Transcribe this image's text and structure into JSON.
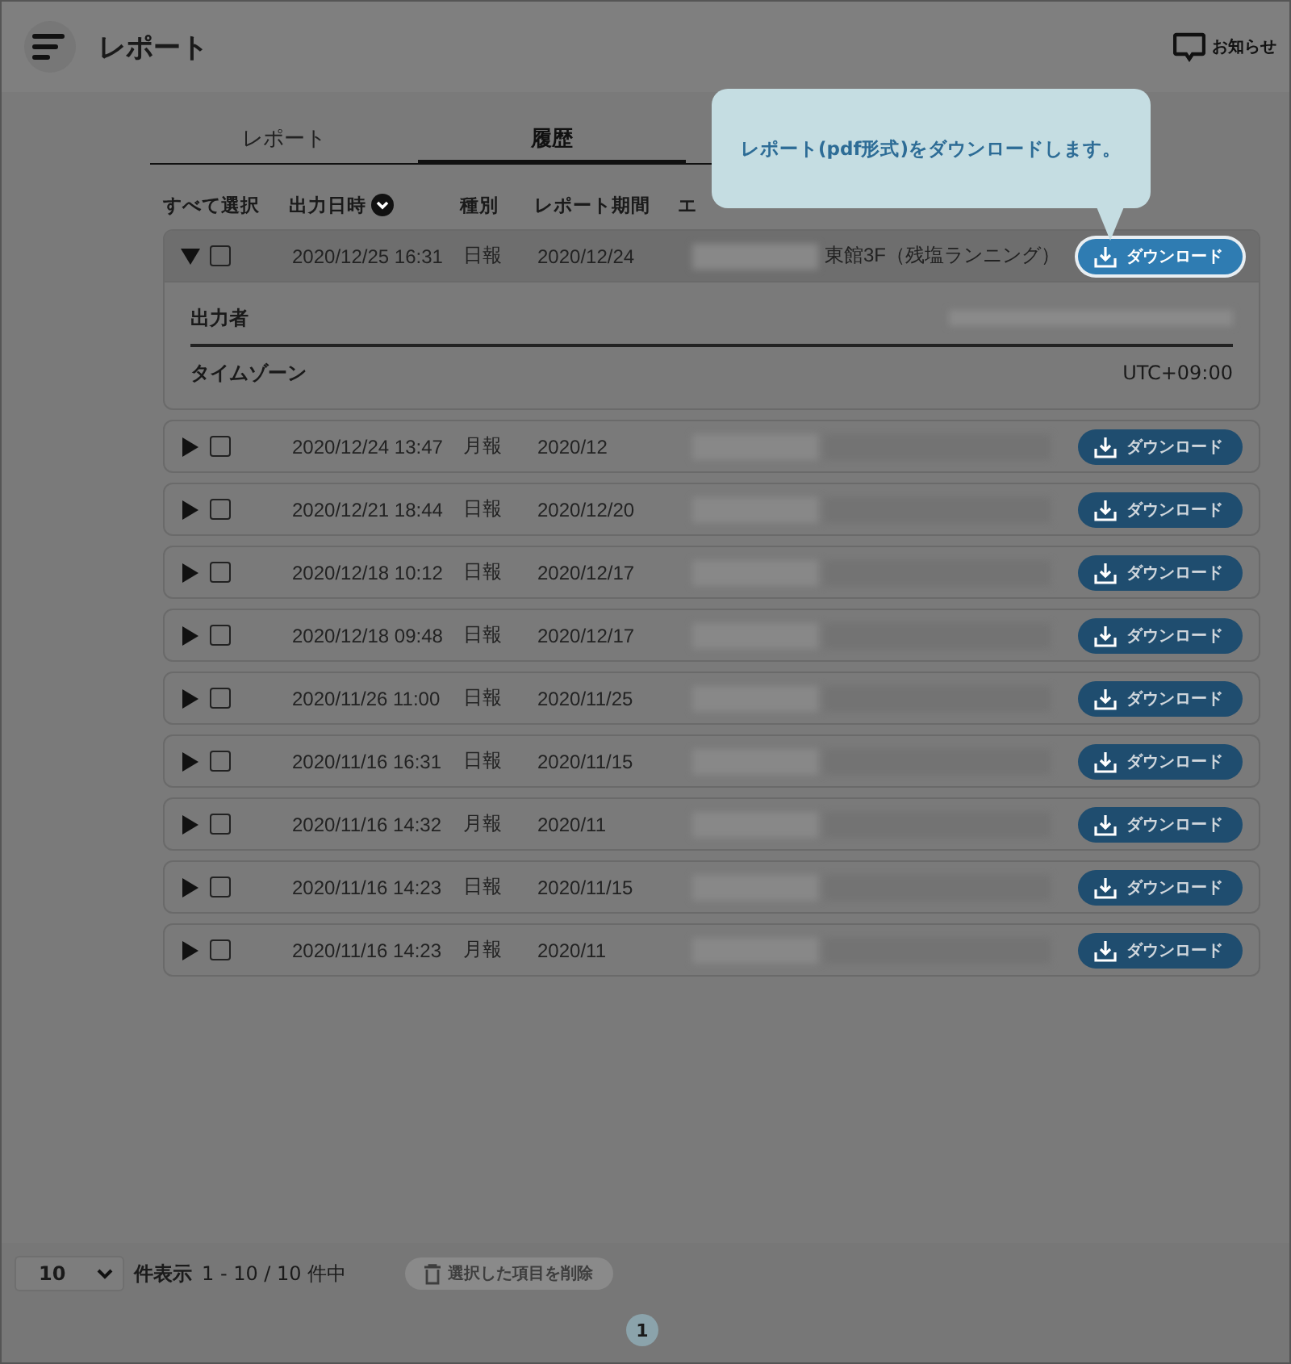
{
  "header": {
    "title": "レポート",
    "notice": "お知らせ"
  },
  "tabs": [
    {
      "label": "レポート",
      "selected": false
    },
    {
      "label": "履歴",
      "selected": true
    }
  ],
  "tooltip": "レポート(pdf形式)をダウンロードします。",
  "columns": [
    "すべて選択",
    "出力日時",
    "種別",
    "レポート期間",
    "エ"
  ],
  "rows": [
    {
      "expanded": true,
      "checked": false,
      "highlighted": true,
      "datetime": "2020/12/25 16:31",
      "type": "日報",
      "period": "2020/12/24",
      "location": "東館3F（残塩ランニング）",
      "download": "ダウンロード",
      "details": [
        {
          "label": "出力者"
        },
        {
          "label": "タイムゾーン",
          "value": "UTC+09:00"
        }
      ]
    },
    {
      "expanded": false,
      "checked": false,
      "highlighted": false,
      "datetime": "2020/12/24 13:47",
      "type": "月報",
      "period": "2020/12",
      "download": "ダウンロード"
    },
    {
      "expanded": false,
      "checked": false,
      "highlighted": false,
      "datetime": "2020/12/21 18:44",
      "type": "日報",
      "period": "2020/12/20",
      "download": "ダウンロード"
    },
    {
      "expanded": false,
      "checked": false,
      "highlighted": false,
      "datetime": "2020/12/18 10:12",
      "type": "日報",
      "period": "2020/12/17",
      "download": "ダウンロード"
    },
    {
      "expanded": false,
      "checked": false,
      "highlighted": false,
      "datetime": "2020/12/18 09:48",
      "type": "日報",
      "period": "2020/12/17",
      "download": "ダウンロード"
    },
    {
      "expanded": false,
      "checked": false,
      "highlighted": false,
      "datetime": "2020/11/26 11:00",
      "type": "日報",
      "period": "2020/11/25",
      "download": "ダウンロード"
    },
    {
      "expanded": false,
      "checked": false,
      "highlighted": false,
      "datetime": "2020/11/16 16:31",
      "type": "日報",
      "period": "2020/11/15",
      "download": "ダウンロード"
    },
    {
      "expanded": false,
      "checked": false,
      "highlighted": false,
      "datetime": "2020/11/16 14:32",
      "type": "月報",
      "period": "2020/11",
      "download": "ダウンロード"
    },
    {
      "expanded": false,
      "checked": false,
      "highlighted": false,
      "datetime": "2020/11/16 14:23",
      "type": "日報",
      "period": "2020/11/15",
      "download": "ダウンロード"
    },
    {
      "expanded": false,
      "checked": false,
      "highlighted": false,
      "datetime": "2020/11/16 14:23",
      "type": "月報",
      "period": "2020/11",
      "download": "ダウンロード"
    }
  ],
  "footer": {
    "per_page": "10",
    "per_page_label": "件表示",
    "range": "1 - 10 / 10 件中",
    "delete": "選択した項目を削除",
    "delete_disabled": true,
    "pages": [
      {
        "label": "1",
        "selected": true
      }
    ]
  }
}
